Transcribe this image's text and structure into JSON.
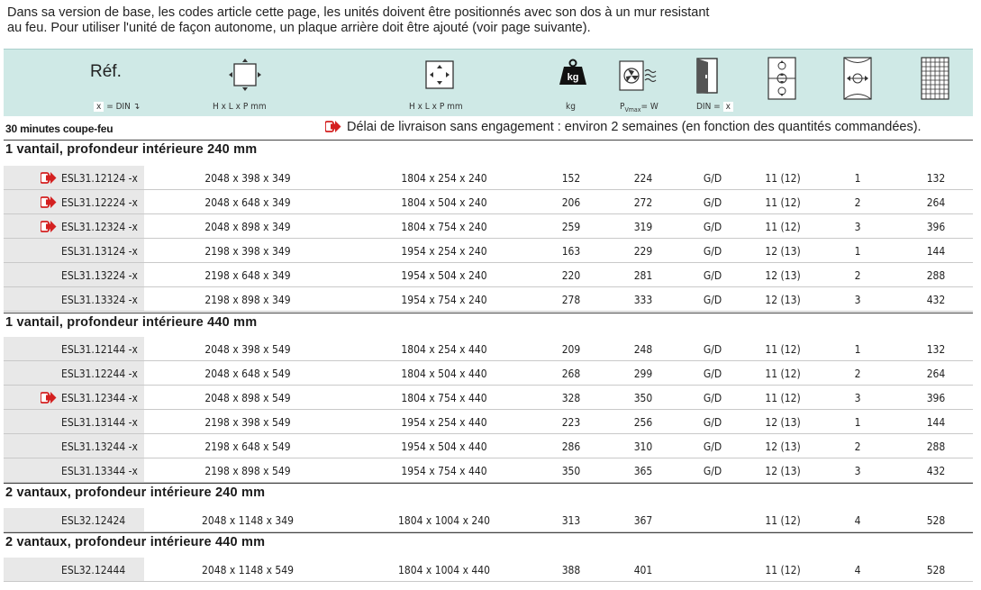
{
  "intro": {
    "line1": "Dans sa version de base, les codes article cette page, les unités doivent être positionnés avec son dos à un mur resistant",
    "line2": "au feu. Pour utiliser l'unité de façon autonome, un plaque arrière doit être ajouté (voir page suivante)."
  },
  "header": {
    "ref_title": "Réf.",
    "ref_sub_x": "x",
    "ref_sub_rest": "= DIN ↴",
    "outer_dims": "H x L x P mm",
    "inner_dims": "H x L x P mm",
    "weight": "kg",
    "weight_icon_label": "kg",
    "power_p": "P",
    "power_sub": "Vmax",
    "power_rest": "= W",
    "din_label": "DIN =",
    "din_x": "x",
    "icons": [
      "outer-dimensions-icon",
      "inner-dimensions-icon",
      "weight-icon",
      "power-icon",
      "door-icon",
      "shelf-icon",
      "door-swing-icon",
      "grid-icon"
    ]
  },
  "notes": {
    "fire_rating": "30 minutes coupe-feu",
    "delivery": "Délai de livraison sans engagement : environ 2 semaines (en fonction des quantités commandées)."
  },
  "colors": {
    "header_bg": "#cfe9e6",
    "ref_cell_bg": "#e8e8e8",
    "arrow_red": "#d42020"
  },
  "sections": [
    {
      "title": "1 vantail, profondeur intérieure 240 mm",
      "rows": [
        {
          "arrow": true,
          "ref": "ESL31.12124 -x",
          "outer": "2048 x 398 x 349",
          "inner": "1804 x 254 x 240",
          "kg": "152",
          "w": "224",
          "din": "G/D",
          "a": "11 (12)",
          "b": "1",
          "c": "132"
        },
        {
          "arrow": true,
          "ref": "ESL31.12224 -x",
          "outer": "2048 x 648 x 349",
          "inner": "1804 x 504 x 240",
          "kg": "206",
          "w": "272",
          "din": "G/D",
          "a": "11 (12)",
          "b": "2",
          "c": "264"
        },
        {
          "arrow": true,
          "ref": "ESL31.12324 -x",
          "outer": "2048 x 898 x 349",
          "inner": "1804 x 754 x 240",
          "kg": "259",
          "w": "319",
          "din": "G/D",
          "a": "11 (12)",
          "b": "3",
          "c": "396"
        },
        {
          "arrow": false,
          "ref": "ESL31.13124 -x",
          "outer": "2198 x 398 x 349",
          "inner": "1954 x 254 x 240",
          "kg": "163",
          "w": "229",
          "din": "G/D",
          "a": "12 (13)",
          "b": "1",
          "c": "144"
        },
        {
          "arrow": false,
          "ref": "ESL31.13224 -x",
          "outer": "2198 x 648 x 349",
          "inner": "1954 x 504 x 240",
          "kg": "220",
          "w": "281",
          "din": "G/D",
          "a": "12 (13)",
          "b": "2",
          "c": "288"
        },
        {
          "arrow": false,
          "ref": "ESL31.13324 -x",
          "outer": "2198 x 898 x 349",
          "inner": "1954 x 754 x 240",
          "kg": "278",
          "w": "333",
          "din": "G/D",
          "a": "12 (13)",
          "b": "3",
          "c": "432"
        }
      ]
    },
    {
      "title": "1 vantail, profondeur intérieure 440 mm",
      "rows": [
        {
          "arrow": false,
          "ref": "ESL31.12144 -x",
          "outer": "2048 x 398 x 549",
          "inner": "1804 x 254 x 440",
          "kg": "209",
          "w": "248",
          "din": "G/D",
          "a": "11 (12)",
          "b": "1",
          "c": "132"
        },
        {
          "arrow": false,
          "ref": "ESL31.12244 -x",
          "outer": "2048 x 648 x 549",
          "inner": "1804 x 504 x 440",
          "kg": "268",
          "w": "299",
          "din": "G/D",
          "a": "11 (12)",
          "b": "2",
          "c": "264"
        },
        {
          "arrow": true,
          "ref": "ESL31.12344 -x",
          "outer": "2048 x 898 x 549",
          "inner": "1804 x 754 x 440",
          "kg": "328",
          "w": "350",
          "din": "G/D",
          "a": "11 (12)",
          "b": "3",
          "c": "396"
        },
        {
          "arrow": false,
          "ref": "ESL31.13144 -x",
          "outer": "2198 x 398 x 549",
          "inner": "1954 x 254 x 440",
          "kg": "223",
          "w": "256",
          "din": "G/D",
          "a": "12 (13)",
          "b": "1",
          "c": "144"
        },
        {
          "arrow": false,
          "ref": "ESL31.13244 -x",
          "outer": "2198 x 648 x 549",
          "inner": "1954 x 504 x 440",
          "kg": "286",
          "w": "310",
          "din": "G/D",
          "a": "12 (13)",
          "b": "2",
          "c": "288"
        },
        {
          "arrow": false,
          "ref": "ESL31.13344 -x",
          "outer": "2198 x 898 x 549",
          "inner": "1954 x 754 x 440",
          "kg": "350",
          "w": "365",
          "din": "G/D",
          "a": "12 (13)",
          "b": "3",
          "c": "432"
        }
      ]
    },
    {
      "title": "2 vantaux, profondeur intérieure 240 mm",
      "rows": [
        {
          "arrow": false,
          "ref": "ESL32.12424",
          "outer": "2048 x 1148 x 349",
          "inner": "1804 x 1004 x 240",
          "kg": "313",
          "w": "367",
          "din": "",
          "a": "11 (12)",
          "b": "4",
          "c": "528"
        }
      ]
    },
    {
      "title": "2 vantaux, profondeur intérieure 440 mm",
      "rows": [
        {
          "arrow": false,
          "ref": "ESL32.12444",
          "outer": "2048 x 1148 x 549",
          "inner": "1804 x 1004 x 440",
          "kg": "388",
          "w": "401",
          "din": "",
          "a": "11 (12)",
          "b": "4",
          "c": "528"
        }
      ]
    }
  ]
}
